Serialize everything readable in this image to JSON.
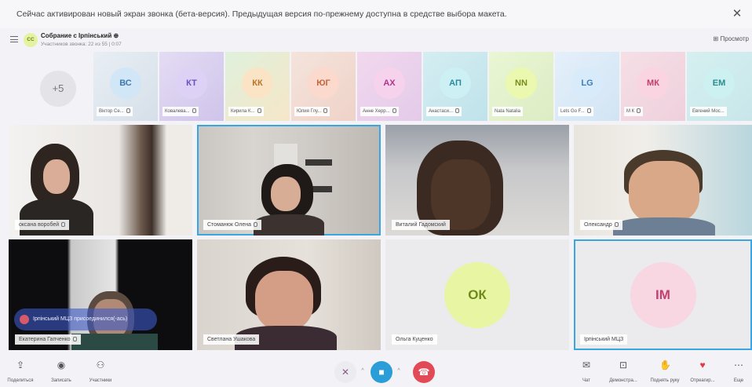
{
  "banner": {
    "text": "Сейчас активирован новый экран звонка (бета-версия). Предыдущая версия по-прежнему доступна в средстве выбора макета.",
    "close": "✕"
  },
  "header": {
    "avatar": "СС",
    "title": "Собрание с Ірпінський ⊕",
    "subtitle": "Участников звонка: 22 из 55 | 0:07",
    "view": "⊞ Просмотр"
  },
  "strip": {
    "more": "+5",
    "thumbs": [
      {
        "initials": "ВС",
        "label": "Віктор Се...",
        "color": "#a8d0ee"
      },
      {
        "initials": "КТ",
        "label": "Ковалева...",
        "color": "#c7b8f0"
      },
      {
        "initials": "КК",
        "label": "Кирила К...",
        "color": "#f5d7b0"
      },
      {
        "initials": "ЮГ",
        "label": "Юлия Глу...",
        "color": "#f9cfc0"
      },
      {
        "initials": "АХ",
        "label": "Анне Херр...",
        "color": "#f0c0e4"
      },
      {
        "initials": "АП",
        "label": "Анастаси...",
        "color": "#b8e6ee"
      },
      {
        "initials": "NN",
        "label": "Nata Natalia",
        "color": "#e4f6a0"
      },
      {
        "initials": "LG",
        "label": "Lets Go F...",
        "color": "#c8e4f8"
      },
      {
        "initials": "МК",
        "label": "М К",
        "color": "#f7c8d4"
      },
      {
        "initials": "ЕМ",
        "label": "Евгений Мос...",
        "color": "#b6e8ea"
      }
    ]
  },
  "tiles": [
    {
      "name": "оксана воробей"
    },
    {
      "name": "Стоманюк Олена"
    },
    {
      "name": "Виталий Гадомский"
    },
    {
      "name": "Олександр"
    },
    {
      "name": "Екатерина Гапченко"
    },
    {
      "name": "Светлана Ушакова"
    },
    {
      "name": "Ольга Куценко",
      "initials": "ОК"
    },
    {
      "name": "Ірпінський МЦЗ",
      "initials": "IM"
    }
  ],
  "toast": {
    "text": "Ірпінський МЦЗ присоединился(-ась)"
  },
  "toolbar": {
    "share": "Поделиться",
    "record": "Записать",
    "participants": "Участники",
    "chat": "Чат",
    "present": "Демонстра...",
    "raise_hand": "Поднять руку",
    "react": "Отреагир...",
    "more": "Еще"
  },
  "colors": {
    "accent": "#3aa5de",
    "end_call": "#e24a55",
    "ok_avatar": "#e8f5a2",
    "im_avatar": "#f8d6e2"
  }
}
